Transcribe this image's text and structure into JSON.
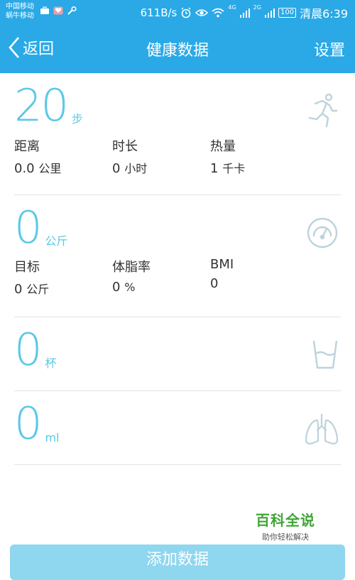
{
  "status_bar": {
    "carrier1": "中国移动",
    "carrier2": "蜗牛移动",
    "speed": "611B/s",
    "net1": "4G",
    "net2": "2G",
    "battery": "100",
    "time": "清晨6:39"
  },
  "header": {
    "back_label": "返回",
    "title": "健康数据",
    "settings_label": "设置"
  },
  "steps": {
    "value": "20",
    "unit": "步",
    "stats": [
      {
        "label": "距离",
        "value": "0.0",
        "unit": "公里"
      },
      {
        "label": "时长",
        "value": "0",
        "unit": "小时"
      },
      {
        "label": "热量",
        "value": "1",
        "unit": "千卡"
      }
    ],
    "icon": "running-icon"
  },
  "weight": {
    "value": "0",
    "unit": "公斤",
    "stats": [
      {
        "label": "目标",
        "value": "0",
        "unit": "公斤"
      },
      {
        "label": "体脂率",
        "value": "0",
        "unit": "%"
      },
      {
        "label": "BMI",
        "value": "0",
        "unit": ""
      }
    ],
    "icon": "scale-gauge-icon"
  },
  "water": {
    "value": "0",
    "unit": "杯",
    "icon": "cup-icon"
  },
  "lung": {
    "value": "0",
    "unit": "ml",
    "icon": "lungs-icon"
  },
  "watermark": {
    "title": "百科全说",
    "subtitle": "助你轻松解决"
  },
  "add_button": {
    "label": "添加数据"
  },
  "colors": {
    "accent": "#2aa9e6",
    "value_blue": "#5bc8e6",
    "icon_gray": "#bcd3dc"
  }
}
